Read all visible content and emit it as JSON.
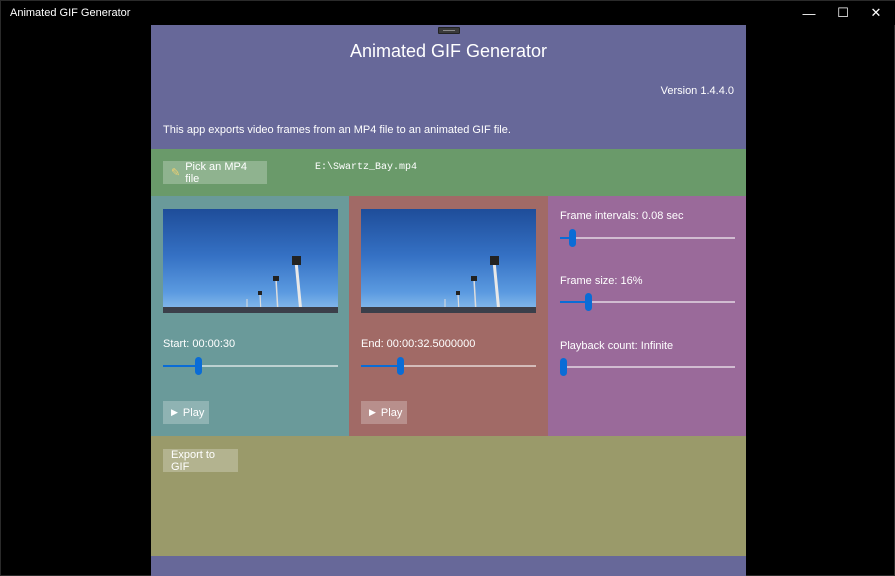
{
  "window": {
    "title": "Animated GIF Generator",
    "minimize_glyph": "—",
    "maximize_glyph": "☐",
    "close_glyph": "✕"
  },
  "header": {
    "title": "Animated GIF Generator",
    "version": "Version 1.4.4.0",
    "description": "This app exports video frames from an MP4 file to an animated GIF file."
  },
  "pick": {
    "button_label": "Pick an MP4 file",
    "button_icon": "magic-wand-icon",
    "file_path": "E:\\Swartz_Bay.mp4"
  },
  "start": {
    "label": "Start: 00:00:30",
    "slider_value": 0.2,
    "play_label": "Play",
    "play_icon": "play-icon"
  },
  "end": {
    "label": "End: 00:00:32.5000000",
    "slider_value": 0.22,
    "play_label": "Play",
    "play_icon": "play-icon"
  },
  "settings": {
    "frame_interval_label": "Frame intervals: 0.08 sec",
    "frame_interval_value": 0.07,
    "frame_size_label": "Frame size: 16%",
    "frame_size_value": 0.16,
    "playback_count_label": "Playback count: Infinite",
    "playback_count_value": 0.0
  },
  "export": {
    "button_label": "Export to GIF"
  },
  "colors": {
    "header": "#676899",
    "pick_section": "#6a9a6a",
    "start_panel": "#6a9a9a",
    "end_panel": "#a16a66",
    "settings_panel": "#9a6a9a",
    "export_section": "#9a9a6a",
    "accent": "#0a6cd6"
  }
}
